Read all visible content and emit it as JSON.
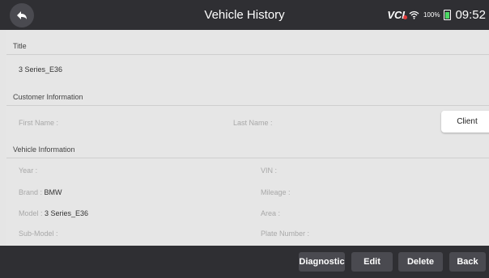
{
  "header": {
    "title": "Vehicle History",
    "vci_label": "VCI",
    "battery_pct": "100%",
    "clock": "09:52"
  },
  "sections": {
    "title_label": "Title",
    "title_value": "3 Series_E36",
    "customer_label": "Customer Information",
    "vehicle_label": "Vehicle Information"
  },
  "customer": {
    "first_name_label": "First Name :",
    "last_name_label": "Last Name :",
    "client_button": "Client"
  },
  "vehicle": {
    "year_label": "Year :",
    "vin_label": "VIN :",
    "brand_label": "Brand : ",
    "brand_value": "BMW",
    "mileage_label": "Mileage :",
    "model_label": "Model : ",
    "model_value": "3 Series_E36",
    "area_label": "Area :",
    "submodel_label": "Sub-Model :",
    "plate_label": "Plate Number :"
  },
  "footer": {
    "diagnostic": "Diagnostic",
    "edit": "Edit",
    "delete": "Delete",
    "back": "Back"
  },
  "colors": {
    "bar": "#2f2f33",
    "background": "#e5e5e5",
    "button": "#4a4a50",
    "battery": "#4cd964"
  },
  "icons": [
    "back-arrow-icon",
    "wifi-icon",
    "battery-icon"
  ]
}
